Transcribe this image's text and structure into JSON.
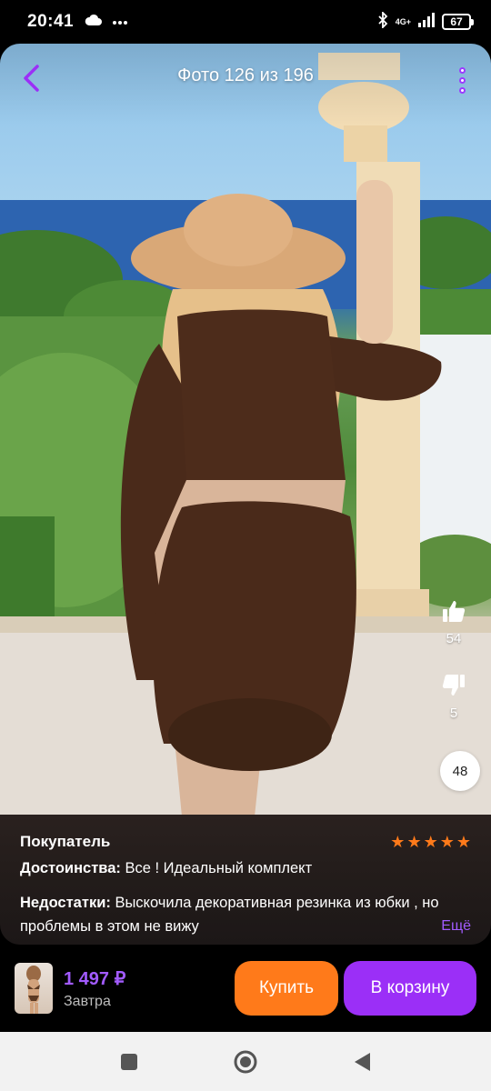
{
  "status_bar": {
    "time": "20:41",
    "network": "4G+",
    "battery": "67",
    "icons": [
      "cloud-icon",
      "more-dots-icon",
      "bluetooth-icon",
      "signal-icon",
      "battery-icon"
    ]
  },
  "header": {
    "photo_counter": "Фото 126 из 196",
    "back_icon": "chevron-left-icon",
    "menu_icon": "vertical-dots-icon"
  },
  "votes": {
    "likes": "54",
    "dislikes": "5",
    "photos_count": "48"
  },
  "review": {
    "reviewer": "Покупатель",
    "rating": 5,
    "pros_label": "Достоинства:",
    "pros_text": "Все ! Идеальный комплект",
    "cons_label": "Недостатки:",
    "cons_text": "Выскочила декоративная резинка из юбки , но проблемы в этом не вижу",
    "more_link": "Ещё"
  },
  "product": {
    "price": "1 497 ₽",
    "delivery": "Завтра",
    "buy_label": "Купить",
    "cart_label": "В корзину"
  },
  "colors": {
    "accent_purple": "#9b2ff7",
    "accent_orange": "#ff7a1a",
    "star_color": "#ff7a1a"
  }
}
